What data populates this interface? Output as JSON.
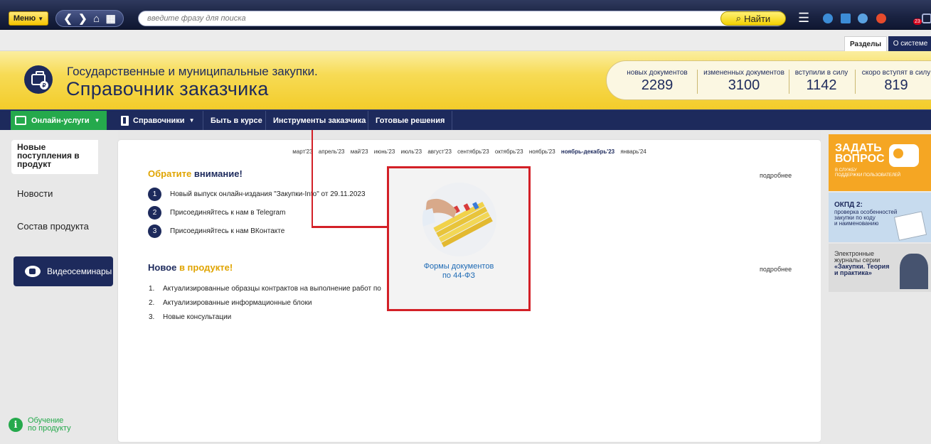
{
  "toolbar": {
    "menu_label": "Меню",
    "nav_back": "❮",
    "nav_forward": "❯",
    "nav_home": "⌂",
    "nav_apps": "▦",
    "search_placeholder": "введите фразу для поиска",
    "find_label": "Найти",
    "notification_count": "23"
  },
  "tabs": {
    "sections": "Разделы",
    "about": "О системе"
  },
  "header": {
    "subtitle": "Государственные и муниципальные закупки.",
    "title": "Справочник заказчика",
    "stats": [
      {
        "label": "новых документов",
        "value": "2289"
      },
      {
        "label": "измененных документов",
        "value": "3100"
      },
      {
        "label": "вступили в силу",
        "value": "1142"
      },
      {
        "label": "скоро вступят в силу",
        "value": "819"
      }
    ]
  },
  "mainnav": {
    "online": "Онлайн-услуги",
    "references": "Справочники",
    "keep_informed": "Быть в курсе",
    "tools": "Инструменты заказчика",
    "solutions": "Готовые решения"
  },
  "sidebar": {
    "new_arrivals": "Новые поступления в продукт",
    "news": "Новости",
    "product": "Состав продукта",
    "webinars": "Видеосеминары",
    "learning_1": "Обучение",
    "learning_2": "по продукту"
  },
  "content": {
    "months": [
      "март'23",
      "апрель'23",
      "май'23",
      "июнь'23",
      "июль'23",
      "август'23",
      "сентябрь'23",
      "октябрь'23",
      "ноябрь'23",
      "ноябрь-декабрь'23",
      "январь'24"
    ],
    "current_month": "ноябрь-декабрь'23",
    "attention_title_a": "Обратите",
    "attention_title_b": "внимание!",
    "more": "подробнее",
    "attention_items": [
      "Новый выпуск онлайн-издания \"Закупки-Info\" от 29.11.2023",
      "Присоединяйтесь к нам в Telegram",
      "Присоединяйтесь к нам ВКонтакте"
    ],
    "new_title_a": "Новое",
    "new_title_b": "в продукте!",
    "new_items": [
      "Актуализированные образцы контрактов на выполнение работ по",
      "Актуализированные информационные блоки",
      "Новые консультации"
    ]
  },
  "card": {
    "caption_1": "Формы документов",
    "caption_2": "по 44-ФЗ"
  },
  "promos": {
    "ask_1": "ЗАДАТЬ",
    "ask_2": "ВОПРОС",
    "ask_small_1": "В СЛУЖБУ",
    "ask_small_2": "ПОДДЕРЖКИ ПОЛЬЗОВАТЕЛЕЙ",
    "okpd_title": "ОКПД 2:",
    "okpd_1": "проверка особенностей",
    "okpd_2": "закупки по коду",
    "okpd_3": "и наименованию",
    "journal_1": "Электронные",
    "journal_2": "журналы серии",
    "journal_3": "«Закупки. Теория",
    "journal_4": "и практика»"
  },
  "colors": {
    "navy": "#1d2a5c",
    "yellow": "#f3cc2a",
    "green": "#25a94c",
    "highlight_red": "#d32027",
    "orange_promo": "#f5a623"
  }
}
